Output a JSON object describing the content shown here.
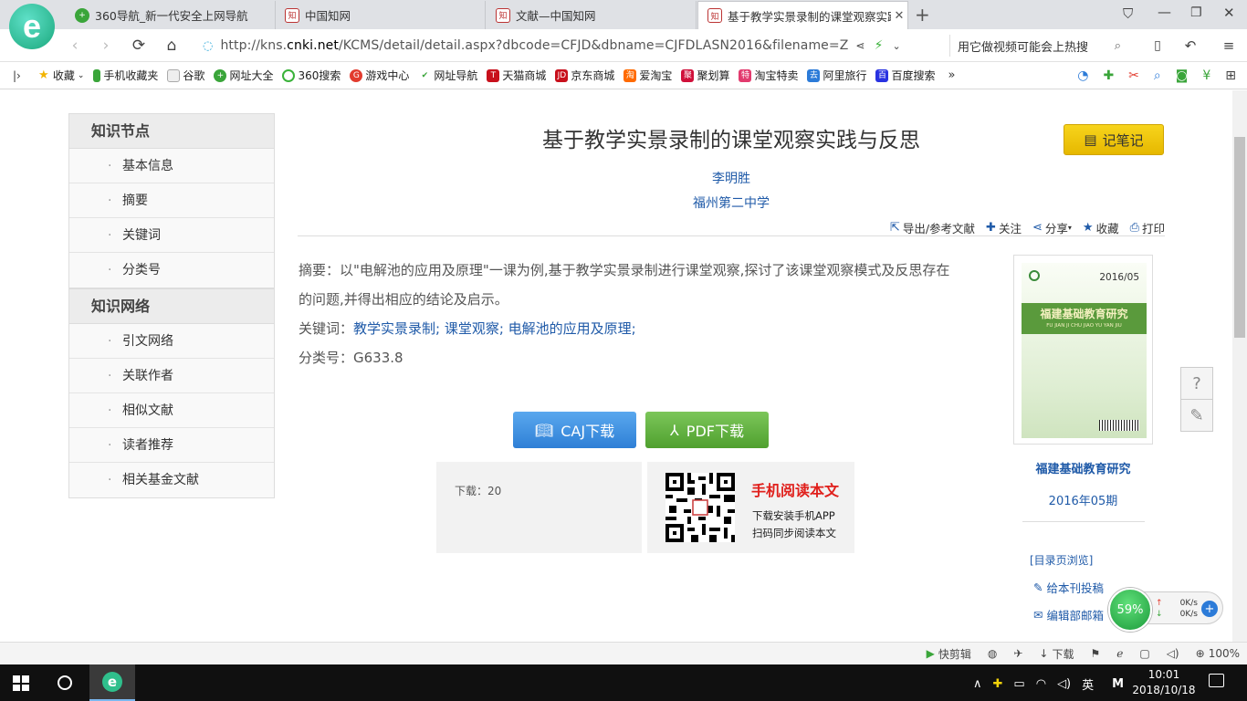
{
  "tabs": [
    {
      "title": "360导航_新一代安全上网导航",
      "icon": "360-nav-icon"
    },
    {
      "title": "中国知网",
      "icon": "cnki-icon"
    },
    {
      "title": "文献—中国知网",
      "icon": "cnki-icon"
    },
    {
      "title": "基于教学实景录制的课堂观察实践与反思",
      "icon": "cnki-icon",
      "active": true
    }
  ],
  "address": {
    "prefix": "http://kns.",
    "domain": "cnki.net",
    "path": "/KCMS/detail/detail.aspx?dbcode=CFJD&dbname=CJFDLASN2016&filename=Z"
  },
  "search_hint": "用它做视频可能会上热搜",
  "bookmarks": [
    "收藏",
    "手机收藏夹",
    "谷歌",
    "网址大全",
    "360搜索",
    "游戏中心",
    "网址导航",
    "天猫商城",
    "京东商城",
    "爱淘宝",
    "聚划算",
    "淘宝特卖",
    "阿里旅行",
    "百度搜索"
  ],
  "leftnav": {
    "group1": {
      "title": "知识节点",
      "items": [
        "基本信息",
        "摘要",
        "关键词",
        "分类号"
      ]
    },
    "group2": {
      "title": "知识网络",
      "items": [
        "引文网络",
        "关联作者",
        "相似文献",
        "读者推荐",
        "相关基金文献"
      ]
    }
  },
  "article": {
    "title": "基于教学实景录制的课堂观察实践与反思",
    "author": "李明胜",
    "org": "福州第二中学",
    "note_button": "记笔记",
    "tools": [
      "导出/参考文献",
      "关注",
      "分享",
      "收藏",
      "打印"
    ],
    "abstract_label": "摘要：",
    "abstract_line1": "以\"电解池的应用及原理\"一课为例,基于教学实景录制进行课堂观察,探讨了该课堂观察模式及反思存在",
    "abstract_line2": "的问题,并得出相应的结论及启示。",
    "keywords_label": "关键词：",
    "keywords": "教学实景录制; 课堂观察; 电解池的应用及原理;",
    "class_label": "分类号：",
    "class_code": "G633.8",
    "caj_button": "CAJ下载",
    "pdf_button": "PDF下载",
    "downloads": "下载：20",
    "mobile_title": "手机阅读本文",
    "mobile_line1": "下载安装手机APP",
    "mobile_line2": "扫码同步阅读本文"
  },
  "journal": {
    "cover_issue": "2016/05",
    "cover_title": "福建基础教育研究",
    "cover_pinyin": "FU JIAN JI CHU JIAO YU YAN JIU",
    "name": "福建基础教育研究",
    "issue": "2016年05期",
    "toc_link": "[目录页浏览]",
    "submit": "给本刊投稿",
    "email": "编辑部邮箱"
  },
  "net_widget": {
    "percent": "59%",
    "up": "0K/s",
    "down": "0K/s"
  },
  "statusbar": [
    "快剪辑",
    "下载",
    "100%"
  ],
  "taskbar": {
    "time": "10:01",
    "date": "2018/10/18",
    "ime": "英",
    "ime2": "M"
  },
  "colors": {
    "link": "#1f5aa8",
    "note_button": "#f0c30f",
    "caj": "#3a8de0",
    "pdf": "#5fb33b",
    "mobile_title": "#e0201c"
  }
}
